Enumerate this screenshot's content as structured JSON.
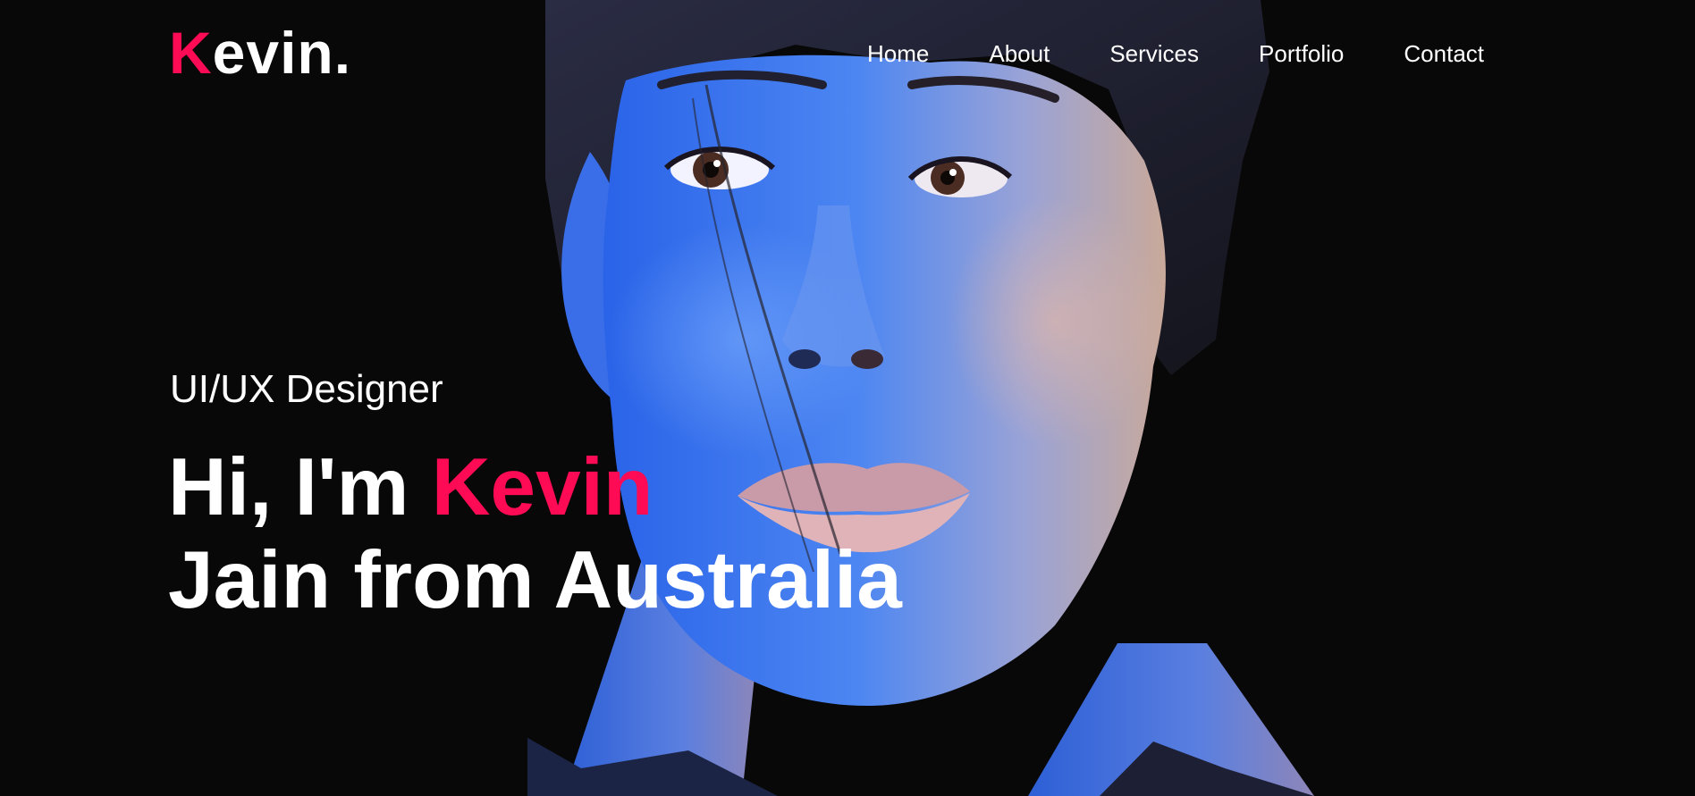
{
  "theme": {
    "background": "#080808",
    "accent": "#ff0a54",
    "text": "#ffffff"
  },
  "logo": {
    "first_letter": "K",
    "rest": "evin."
  },
  "nav": {
    "items": [
      {
        "label": "Home"
      },
      {
        "label": "About"
      },
      {
        "label": "Services"
      },
      {
        "label": "Portfolio"
      },
      {
        "label": "Contact"
      }
    ]
  },
  "hero": {
    "subtitle": "UI/UX Designer",
    "headline_prefix": "Hi, I'm ",
    "headline_name": "Kevin",
    "headline_line2": "Jain from Australia",
    "image": "portrait-photo"
  }
}
